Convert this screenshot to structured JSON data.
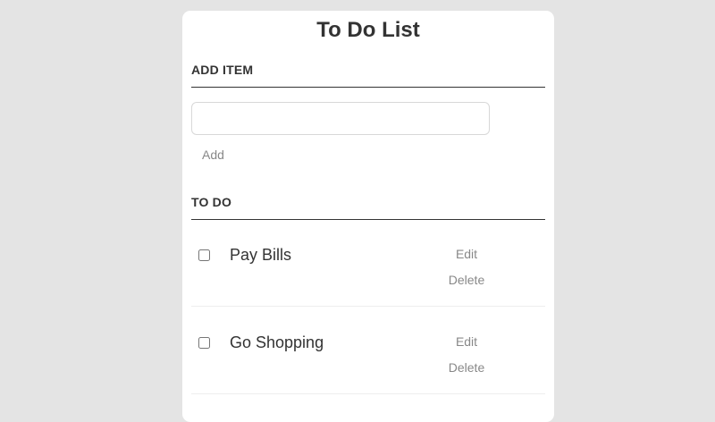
{
  "page": {
    "title": "To Do List"
  },
  "add_section": {
    "heading": "ADD ITEM",
    "input_value": "",
    "add_label": "Add"
  },
  "todo_section": {
    "heading": "TO DO",
    "items": [
      {
        "label": "Pay Bills",
        "checked": false,
        "edit_label": "Edit",
        "delete_label": "Delete"
      },
      {
        "label": "Go Shopping",
        "checked": false,
        "edit_label": "Edit",
        "delete_label": "Delete"
      }
    ]
  },
  "colors": {
    "background": "#e4e4e4",
    "card": "#ffffff",
    "text": "#333333",
    "muted": "#888888"
  }
}
